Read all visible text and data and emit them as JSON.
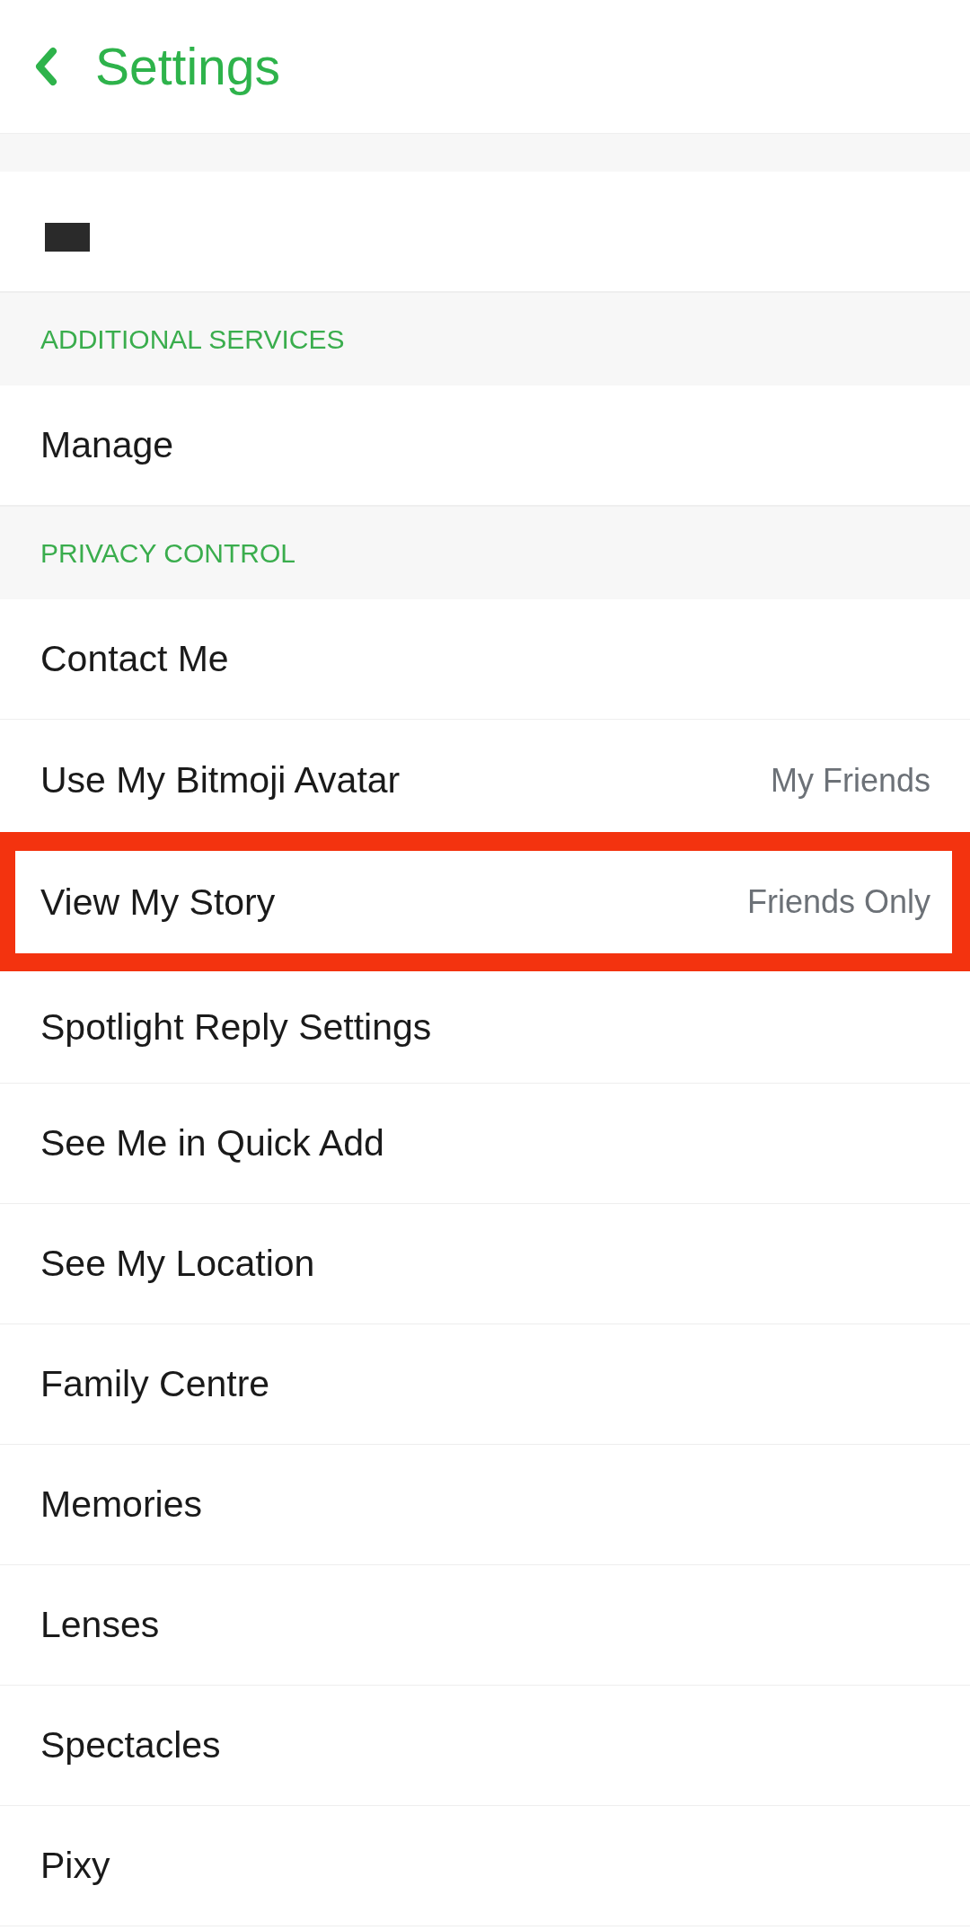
{
  "header": {
    "title": "Settings"
  },
  "sections": [
    {
      "items": [
        {
          "kind": "redacted",
          "highlighted": false
        }
      ]
    },
    {
      "title": "ADDITIONAL SERVICES",
      "items": [
        {
          "kind": "link",
          "label": "Manage",
          "highlighted": false
        }
      ]
    },
    {
      "title": "PRIVACY CONTROL",
      "items": [
        {
          "kind": "link",
          "label": "Contact Me",
          "highlighted": false
        },
        {
          "kind": "link",
          "label": "Use My Bitmoji Avatar",
          "value": "My Friends",
          "highlighted": false
        },
        {
          "kind": "link",
          "label": "View My Story",
          "value": "Friends Only",
          "highlighted": true
        },
        {
          "kind": "link",
          "label": "Spotlight Reply Settings",
          "highlighted": false
        },
        {
          "kind": "link",
          "label": "See Me in Quick Add",
          "highlighted": false
        },
        {
          "kind": "link",
          "label": "See My Location",
          "highlighted": false
        },
        {
          "kind": "link",
          "label": "Family Centre",
          "highlighted": false
        },
        {
          "kind": "link",
          "label": "Memories",
          "highlighted": false
        },
        {
          "kind": "link",
          "label": "Lenses",
          "highlighted": false
        },
        {
          "kind": "link",
          "label": "Spectacles",
          "highlighted": false
        },
        {
          "kind": "link",
          "label": "Pixy",
          "highlighted": false
        }
      ]
    }
  ]
}
